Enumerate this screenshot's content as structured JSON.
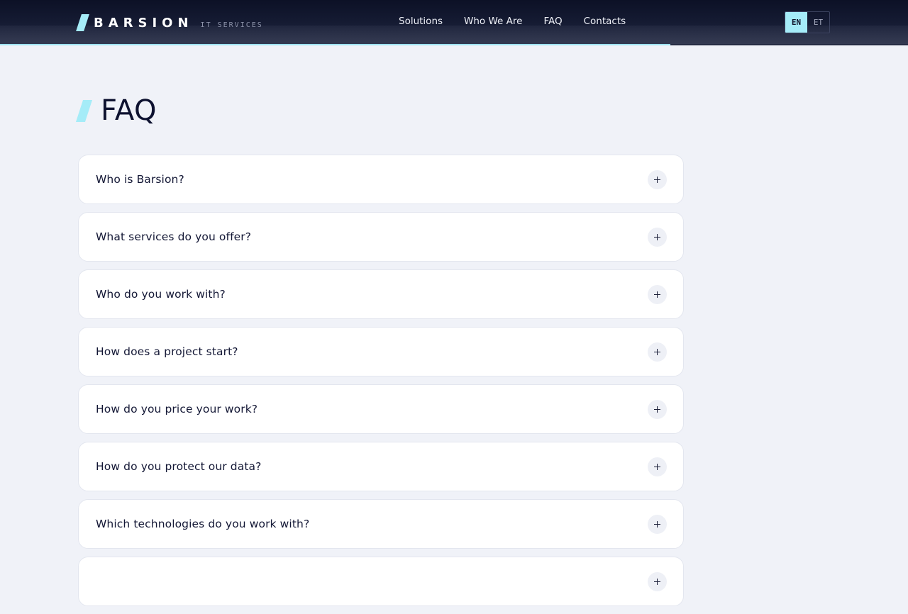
{
  "header": {
    "logo_word": "BARSION",
    "logo_sub": "IT SERVICES",
    "nav": [
      {
        "label": "Solutions",
        "name": "nav-solutions"
      },
      {
        "label": "Who We Are",
        "name": "nav-who-we-are"
      },
      {
        "label": "FAQ",
        "name": "nav-faq"
      },
      {
        "label": "Contacts",
        "name": "nav-contacts"
      }
    ],
    "languages": [
      {
        "code": "EN",
        "active": true
      },
      {
        "code": "ET",
        "active": false
      }
    ]
  },
  "page": {
    "title": "FAQ"
  },
  "faq": [
    {
      "question": "Who is Barsion?"
    },
    {
      "question": "What services do you offer?"
    },
    {
      "question": "Who do you work with?"
    },
    {
      "question": "How does a project start?"
    },
    {
      "question": "How do you price your work?"
    },
    {
      "question": "How do you protect our data?"
    },
    {
      "question": "Which technologies do you work with?"
    },
    {
      "question": ""
    }
  ],
  "colors": {
    "accent": "#a5ecf8",
    "header_bg": "#0c1126",
    "page_bg": "#f0f2f8",
    "card_bg": "#ffffff",
    "text": "#10142a"
  },
  "icons": {
    "expand": "plus-icon",
    "logo": "slash-logo-mark"
  }
}
